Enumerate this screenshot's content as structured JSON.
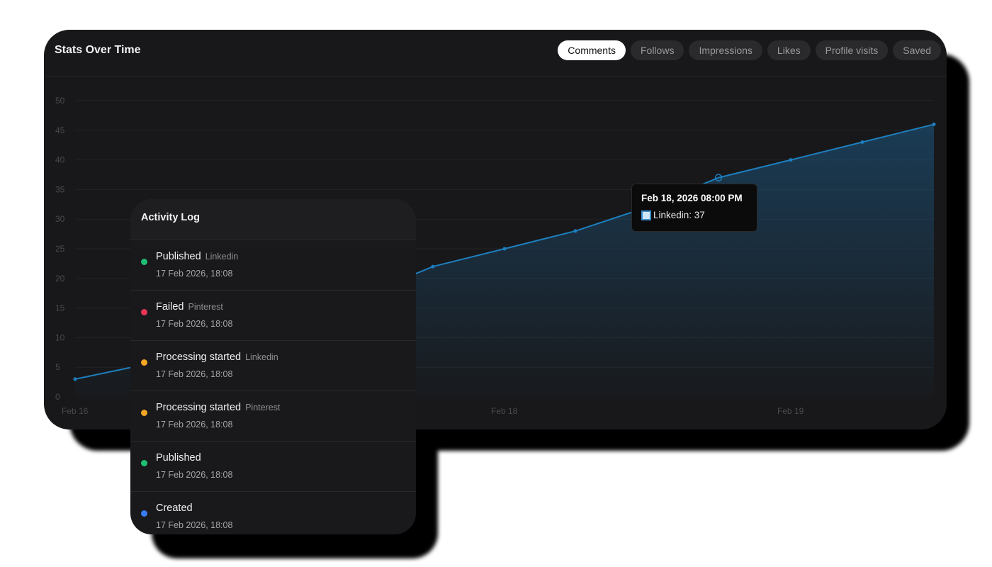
{
  "stats": {
    "title": "Stats Over Time",
    "tabs": [
      {
        "label": "Comments",
        "active": true
      },
      {
        "label": "Follows",
        "active": false
      },
      {
        "label": "Impressions",
        "active": false
      },
      {
        "label": "Likes",
        "active": false
      },
      {
        "label": "Profile visits",
        "active": false
      },
      {
        "label": "Saved",
        "active": false
      }
    ]
  },
  "chart_data": {
    "type": "area",
    "y_ticks": [
      "0",
      "5",
      "10",
      "15",
      "20",
      "25",
      "30",
      "35",
      "40",
      "45",
      "50"
    ],
    "ylim": [
      0,
      50
    ],
    "x_labels": [
      "Feb 16",
      "Feb 18",
      "Feb 19"
    ],
    "series": [
      {
        "name": "Linkedin",
        "values": [
          3,
          5.5,
          8.5,
          13,
          17,
          22,
          25,
          28,
          32,
          37,
          40,
          43,
          46
        ]
      }
    ],
    "line_color": "#1d7fbf",
    "grid": true
  },
  "tooltip": {
    "title": "Feb 18, 2026  08:00 PM",
    "series_label": "Linkedin: 37"
  },
  "activity_log": {
    "title": "Activity Log",
    "items": [
      {
        "event": "Published",
        "platform": "Linkedin",
        "time": "17 Feb 2026, 18:08",
        "color": "#1fbf75"
      },
      {
        "event": "Failed",
        "platform": "Pinterest",
        "time": "17 Feb 2026, 18:08",
        "color": "#e8365a"
      },
      {
        "event": "Processing started",
        "platform": "Linkedin",
        "time": "17 Feb 2026, 18:08",
        "color": "#f5a623"
      },
      {
        "event": "Processing started",
        "platform": "Pinterest",
        "time": "17 Feb 2026, 18:08",
        "color": "#f5a623"
      },
      {
        "event": "Published",
        "platform": "",
        "time": "17 Feb 2026, 18:08",
        "color": "#1fbf75"
      },
      {
        "event": "Created",
        "platform": "",
        "time": "17 Feb 2026, 18:08",
        "color": "#3a7cf0"
      }
    ]
  }
}
